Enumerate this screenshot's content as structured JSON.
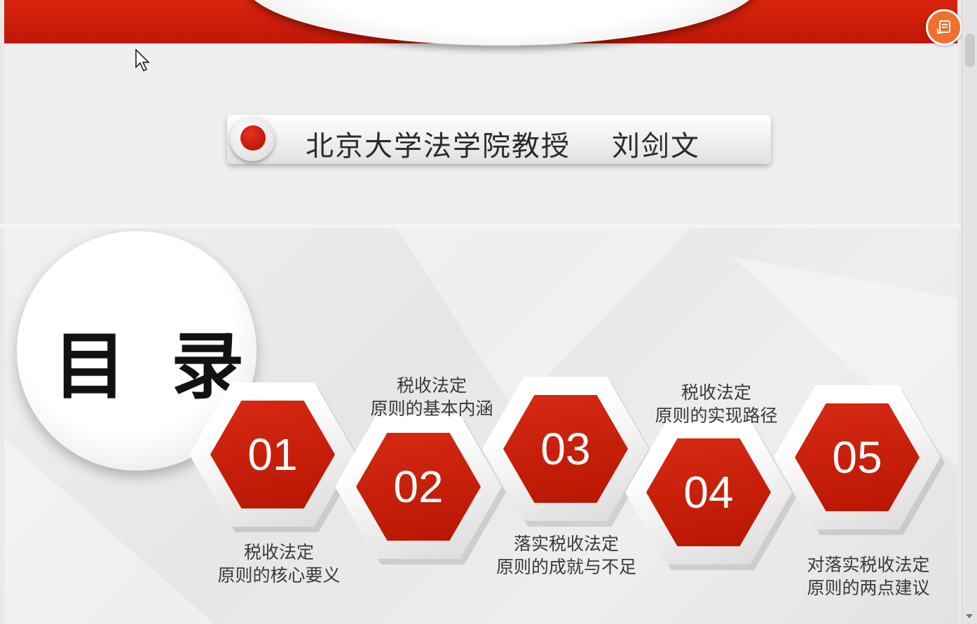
{
  "presenter": {
    "title": "北京大学法学院教授    刘剑文"
  },
  "toc": {
    "heading": "目 录",
    "items": [
      {
        "number": "01",
        "caption_line1": "税收法定",
        "caption_line2": "原则的核心要义"
      },
      {
        "number": "02",
        "caption_line1": "税收法定",
        "caption_line2": "原则的基本内涵"
      },
      {
        "number": "03",
        "caption_line1": "落实税收法定",
        "caption_line2": "原则的成就与不足"
      },
      {
        "number": "04",
        "caption_line1": "税收法定",
        "caption_line2": "原则的实现路径"
      },
      {
        "number": "05",
        "caption_line1": "对落实税收法定",
        "caption_line2": "原则的两点建议"
      }
    ]
  },
  "colors": {
    "accent_red": "#c8200a",
    "float_button": "#f07030"
  },
  "icons": {
    "float_button": "document-edit-icon",
    "cursor": "mouse-pointer-icon"
  }
}
